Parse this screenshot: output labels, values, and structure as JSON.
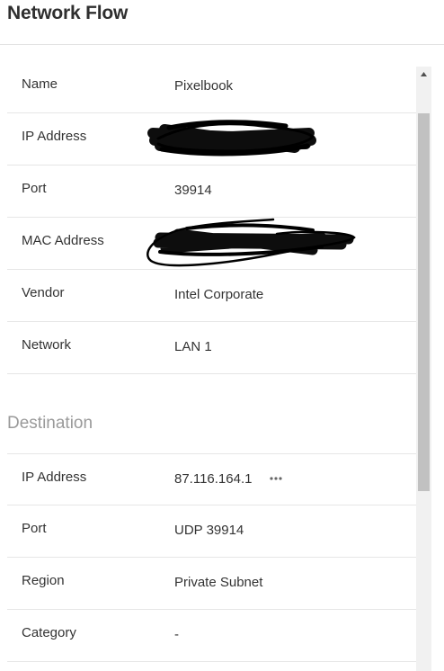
{
  "header": {
    "title": "Network Flow"
  },
  "source": {
    "rows": [
      {
        "label": "Name",
        "value": "Pixelbook"
      },
      {
        "label": "IP Address",
        "value": ""
      },
      {
        "label": "Port",
        "value": "39914"
      },
      {
        "label": "MAC Address",
        "value": ""
      },
      {
        "label": "Vendor",
        "value": "Intel Corporate"
      },
      {
        "label": "Network",
        "value": "LAN 1"
      }
    ]
  },
  "destination": {
    "title": "Destination",
    "rows": [
      {
        "label": "IP Address",
        "value": "87.116.164.1"
      },
      {
        "label": "Port",
        "value": "UDP 39914"
      },
      {
        "label": "Region",
        "value": "Private Subnet"
      },
      {
        "label": "Category",
        "value": "-"
      }
    ]
  },
  "icons": {
    "more": "more-horizontal-icon",
    "scroll_up": "scroll-up-arrow-icon"
  }
}
